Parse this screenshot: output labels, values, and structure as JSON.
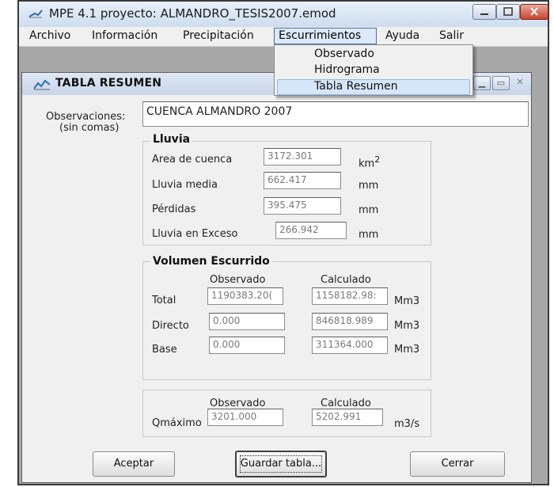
{
  "window": {
    "title": "MPE 4.1 proyecto: ALMANDRO_TESIS2007.emod"
  },
  "menubar": {
    "items": [
      "Archivo",
      "Información",
      "Precipitación",
      "Escurrimientos",
      "Ayuda",
      "Salir"
    ]
  },
  "dropdown": {
    "items": [
      "Observado",
      "Hidrograma",
      "Tabla Resumen"
    ],
    "highlighted": "Tabla Resumen"
  },
  "child_window": {
    "title": "TABLA RESUMEN"
  },
  "observaciones": {
    "label_line1": "Observaciones:",
    "label_line2": "(sin comas)",
    "value": "CUENCA ALMANDRO 2007"
  },
  "lluvia": {
    "title": "Lluvia",
    "rows": [
      {
        "label": "Area de cuenca",
        "value": "3172.301",
        "unit": "km",
        "unit_sup": "2"
      },
      {
        "label": "Lluvia media",
        "value": "662.417",
        "unit": "mm"
      },
      {
        "label": "Pérdidas",
        "value": "395.475",
        "unit": "mm"
      },
      {
        "label": "Lluvia en Exceso",
        "value": "266.942",
        "unit": "mm"
      }
    ]
  },
  "volumen": {
    "title": "Volumen Escurrido",
    "col_observado": "Observado",
    "col_calculado": "Calculado",
    "rows": [
      {
        "label": "Total",
        "observado": "1190383.20(",
        "calculado": "1158182.98:",
        "unit": "Mm3"
      },
      {
        "label": "Directo",
        "observado": "0.000",
        "calculado": "846818.989",
        "unit": "Mm3"
      },
      {
        "label": "Base",
        "observado": "0.000",
        "calculado": "311364.000",
        "unit": "Mm3"
      }
    ]
  },
  "qmaximo": {
    "col_observado": "Observado",
    "col_calculado": "Calculado",
    "label": "Qmáximo",
    "observado": "3201.000",
    "calculado": "5202.991",
    "unit": "m3/s"
  },
  "buttons": {
    "aceptar": "Aceptar",
    "guardar": "Guardar tabla...",
    "cerrar": "Cerrar"
  }
}
